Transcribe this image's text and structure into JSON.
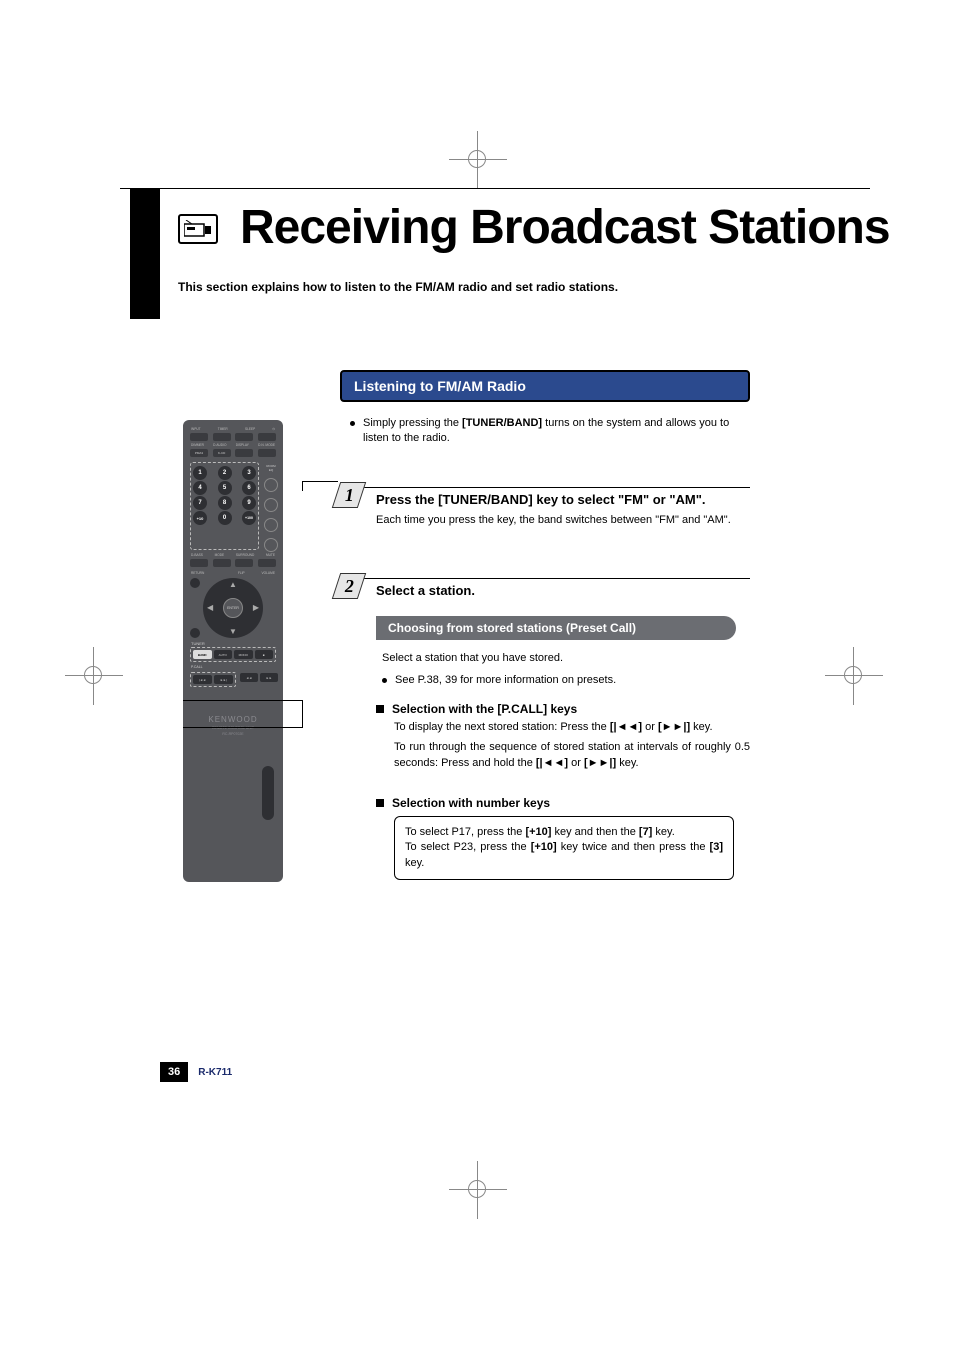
{
  "header": {
    "title": "Receiving Broadcast Stations",
    "subtitle": "This section explains how to listen to the FM/AM radio and set radio stations."
  },
  "remote": {
    "row1_labels": [
      "INPUT",
      "TIMER",
      "SLEEP",
      ""
    ],
    "row2_labels": [
      "DIMMER",
      "D.AUDIO",
      "DISPLAY",
      "D.N. MODE"
    ],
    "row2_btns": [
      "PMA3",
      "K-CD",
      "",
      ""
    ],
    "num_side_label": "ROOM EQ",
    "numbers": [
      "1",
      "2",
      "3",
      "4",
      "5",
      "6",
      "7",
      "8",
      "9",
      "+10",
      "0",
      "+100"
    ],
    "mid_labels": [
      "D-BASS",
      "MODE",
      "SURROUND",
      "MUTE"
    ],
    "cursor_label_left": "RETURN",
    "cursor_label_right_1": "FLIP",
    "cursor_label_right_2": "VOLUME",
    "cursor_ctr": "ENTER",
    "tuner_label": "TUNER",
    "tuner_btns": [
      "BAND",
      "AUTO",
      "MONO",
      "■"
    ],
    "pcall_label": "P.CALL",
    "pcall_btns": [
      "|◄◄",
      "►►|"
    ],
    "seek_btns": [
      "◄◄",
      "►►"
    ],
    "brand": "KENWOOD",
    "brand_sub1": "REMOTE CONTROL UNIT",
    "brand_sub2": "RC-RP0702E"
  },
  "section_bar": "Listening to FM/AM Radio",
  "intro_bullet": {
    "pre": "Simply pressing the ",
    "key": "[TUNER/BAND]",
    "post": " turns on the system and allows you to listen to the radio."
  },
  "step1": {
    "num": "1",
    "head": "Press the [TUNER/BAND] key to select \"FM\" or \"AM\".",
    "text": "Each time you press the key, the band switches between \"FM\" and \"AM\"."
  },
  "step2": {
    "num": "2",
    "head": "Select a station.",
    "graybar": "Choosing from stored stations (Preset Call)",
    "line1": "Select a station that you have stored.",
    "bullet": "See P.38, 39 for more information on presets.",
    "sel_pcall_head": "Selection with the [P.CALL] keys",
    "sel_pcall_1_a": "To display the next stored station: Press the ",
    "sel_pcall_1_b": "[|◄◄]",
    "sel_pcall_1_c": " or ",
    "sel_pcall_1_d": "[►►|]",
    "sel_pcall_1_e": " key.",
    "sel_pcall_2_a": "To run through the sequence of stored station at intervals of roughly 0.5 seconds: Press and hold the ",
    "sel_pcall_2_b": "[|◄◄]",
    "sel_pcall_2_c": " or ",
    "sel_pcall_2_d": "[►►|]",
    "sel_pcall_2_e": " key.",
    "sel_num_head": "Selection with number keys",
    "box_1a": "To select P17, press the ",
    "box_1b": "[+10]",
    "box_1c": " key and then the ",
    "box_1d": "[7]",
    "box_1e": " key.",
    "box_2a": "To select P23, press the ",
    "box_2b": "[+10]",
    "box_2c": " key twice and then press the ",
    "box_2d": "[3]",
    "box_2e": " key."
  },
  "footer": {
    "page": "36",
    "model": "R-K711"
  }
}
